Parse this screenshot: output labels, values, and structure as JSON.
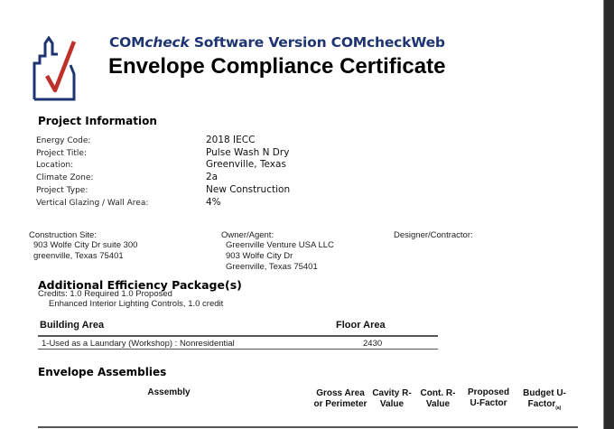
{
  "header": {
    "subtitle_brand": "COM",
    "subtitle_italic": "check",
    "subtitle_rest": " Software Version COMcheckWeb",
    "title": "Envelope Compliance Certificate"
  },
  "project_info": {
    "heading": "Project Information",
    "rows": [
      {
        "label": "Energy Code:",
        "value": "2018 IECC"
      },
      {
        "label": "Project Title:",
        "value": "Pulse Wash N Dry"
      },
      {
        "label": "Location:",
        "value": "Greenville, Texas"
      },
      {
        "label": "Climate Zone:",
        "value": "2a"
      },
      {
        "label": "Project Type:",
        "value": "New Construction"
      },
      {
        "label": "Vertical Glazing / Wall Area:",
        "value": "4%"
      }
    ]
  },
  "parties": {
    "site": {
      "label": "Construction Site:",
      "lines": [
        "903 Wolfe City Dr suite 300",
        "greenville, Texas 75401"
      ]
    },
    "owner": {
      "label": "Owner/Agent:",
      "lines": [
        "Greenville Venture USA LLC",
        "903 Wolfe City Dr",
        "Greenville, Texas 75401"
      ]
    },
    "designer": {
      "label": "Designer/Contractor:"
    }
  },
  "efficiency": {
    "heading": "Additional Efficiency Package(s)",
    "credits": "Credits:  1.0 Required   1.0 Proposed",
    "item": "Enhanced Interior Lighting Controls, 1.0 credit"
  },
  "building_area": {
    "col_area": "Building Area",
    "col_floor": "Floor Area",
    "rows": [
      {
        "area": "1-Used as a Laundary (Workshop) : Nonresidential",
        "floor": "2430"
      }
    ]
  },
  "envelope": {
    "heading": "Envelope Assemblies",
    "columns": [
      "Assembly",
      "Gross Area or Perimeter",
      "Cavity R-Value",
      "Cont. R-Value",
      "Proposed U-Factor",
      "Budget U-Factor"
    ],
    "budget_note": "(a)"
  }
}
